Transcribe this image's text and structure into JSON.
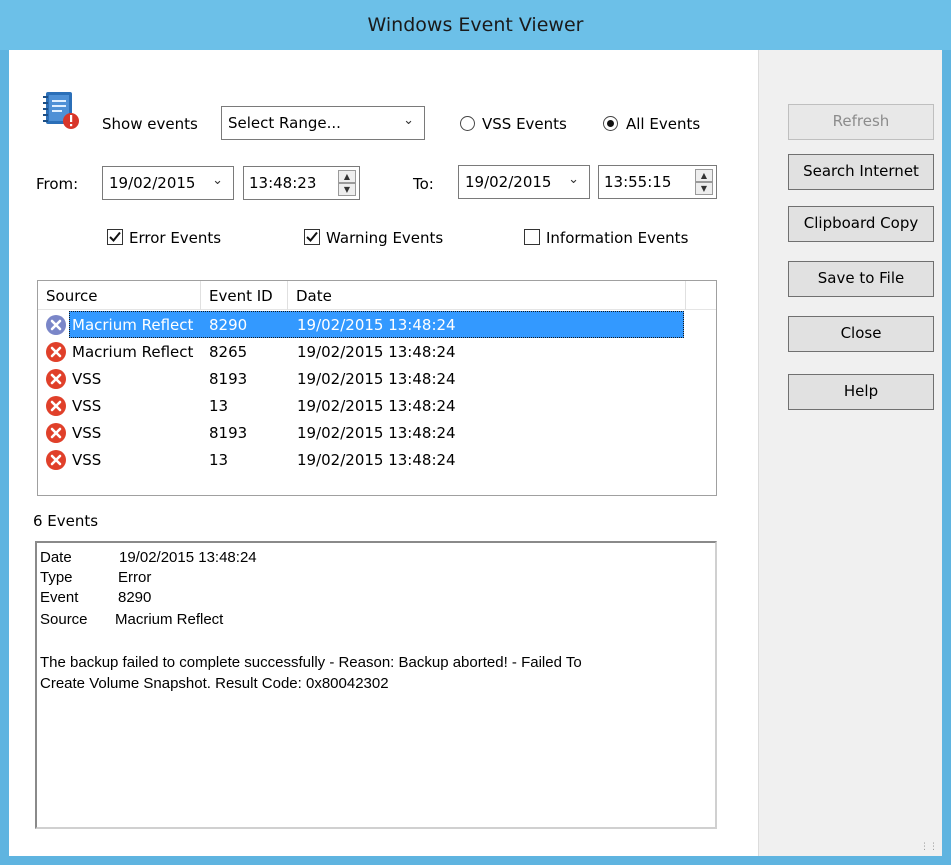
{
  "window": {
    "title": "Windows Event Viewer"
  },
  "filter": {
    "show_events_label": "Show events",
    "range_value": "Select Range...",
    "radio_vss_label": "VSS Events",
    "radio_all_label": "All Events",
    "selected_radio": "All Events",
    "from_label": "From:",
    "from_date": "19/02/2015",
    "from_time": "13:48:23",
    "to_label": "To:",
    "to_date": "19/02/2015",
    "to_time": "13:55:15",
    "error_label": "Error Events",
    "error_checked": true,
    "warning_label": "Warning Events",
    "warning_checked": true,
    "info_label": "Information Events",
    "info_checked": false
  },
  "list": {
    "columns": [
      "Source",
      "Event ID",
      "Date"
    ],
    "rows": [
      {
        "source": "Macrium Reflect",
        "event_id": "8290",
        "date": "19/02/2015 13:48:24",
        "icon": "error-icon",
        "selected": true
      },
      {
        "source": "Macrium Reflect",
        "event_id": "8265",
        "date": "19/02/2015 13:48:24",
        "icon": "error-icon",
        "selected": false
      },
      {
        "source": "VSS",
        "event_id": "8193",
        "date": "19/02/2015 13:48:24",
        "icon": "error-icon",
        "selected": false
      },
      {
        "source": "VSS",
        "event_id": "13",
        "date": "19/02/2015 13:48:24",
        "icon": "error-icon",
        "selected": false
      },
      {
        "source": "VSS",
        "event_id": "8193",
        "date": "19/02/2015 13:48:24",
        "icon": "error-icon",
        "selected": false
      },
      {
        "source": "VSS",
        "event_id": "13",
        "date": "19/02/2015 13:48:24",
        "icon": "error-icon",
        "selected": false
      }
    ]
  },
  "count_label": "6 Events",
  "detail": {
    "date_key": "Date",
    "date_val": "19/02/2015 13:48:24",
    "type_key": "Type",
    "type_val": "Error",
    "event_key": "Event",
    "event_val": "8290",
    "source_key": "Source",
    "source_val": "Macrium Reflect",
    "message_line1": "The backup failed to complete successfully - Reason: Backup aborted! - Failed To",
    "message_line2": "Create Volume Snapshot. Result Code: 0x80042302"
  },
  "buttons": {
    "refresh": "Refresh",
    "search_internet": "Search Internet",
    "clipboard_copy": "Clipboard Copy",
    "save_to_file": "Save to File",
    "close": "Close",
    "help": "Help"
  },
  "colors": {
    "titlebar": "#6cc0e8",
    "selection": "#3399ff",
    "error_red": "#e0402a",
    "selected_icon": "#7a86c8"
  }
}
